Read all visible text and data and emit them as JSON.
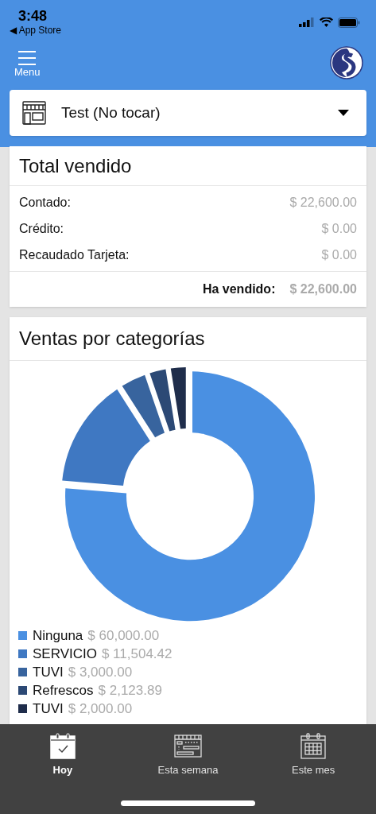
{
  "status_bar": {
    "time": "3:48",
    "back_label": "◀ App Store"
  },
  "header": {
    "menu_label": "Menu"
  },
  "store_selector": {
    "value": "Test (No tocar)"
  },
  "total_card": {
    "title": "Total vendido",
    "rows": [
      {
        "label": "Contado:",
        "amount": "$ 22,600.00"
      },
      {
        "label": "Crédito:",
        "amount": "$ 0.00"
      },
      {
        "label": "Recaudado Tarjeta:",
        "amount": "$ 0.00"
      }
    ],
    "total_label": "Ha vendido:",
    "total_amount": "$ 22,600.00"
  },
  "category_card": {
    "title": "Ventas por categorías",
    "chart_data": {
      "type": "donut",
      "categories": [
        "Ninguna",
        "SERVICIO",
        "TUVI",
        "Refrescos",
        "TUVI"
      ],
      "values": [
        76.31,
        14.63,
        3.82,
        2.7,
        2.54
      ]
    },
    "legend": [
      {
        "amount": "$ 60,000.00",
        "color": "#4a90e2"
      },
      {
        "amount": "$ 11,504.42",
        "color": "#3f78c2"
      },
      {
        "amount": "$ 3,000.00",
        "color": "#38649e"
      },
      {
        "amount": "$ 2,123.89",
        "color": "#2c4975"
      },
      {
        "amount": "$ 2,000.00",
        "color": "#1f2d4b"
      }
    ]
  },
  "tab_bar": [
    {
      "label": "Hoy",
      "kind": "day",
      "selected": true
    },
    {
      "label": "Esta semana",
      "kind": "week",
      "selected": false
    },
    {
      "label": "Este mes",
      "kind": "month",
      "selected": false
    }
  ]
}
